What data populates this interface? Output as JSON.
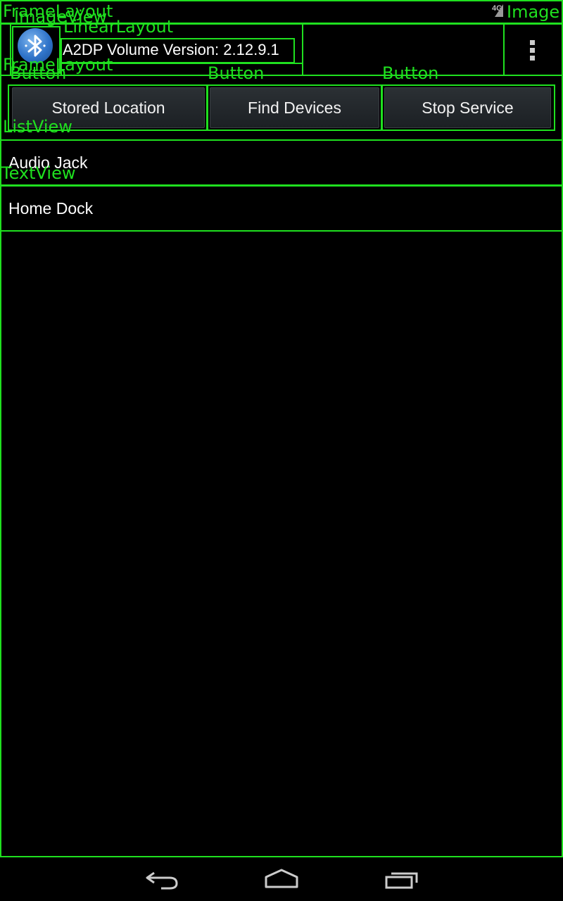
{
  "status_bar": {
    "network_label": "4G"
  },
  "action_bar": {
    "title": "A2DP Volume Version: 2.12.9.1",
    "icon": "bluetooth-icon",
    "menu_icon": "overflow-menu-icon"
  },
  "buttons": {
    "stored_location": "Stored Location",
    "find_devices": "Find Devices",
    "stop_service": "Stop Service"
  },
  "device_list": {
    "items": [
      {
        "label": "Audio Jack"
      },
      {
        "label": "Home Dock"
      }
    ]
  },
  "nav_bar": {
    "back_icon": "back-icon",
    "home_icon": "home-icon",
    "recents_icon": "recent-apps-icon"
  },
  "overlay_labels": {
    "frame_layout": "FrameLayout",
    "image_view": "ImageView",
    "linear_layout": "LinearLayout",
    "text_view": "TextView",
    "button": "Button",
    "list_view": "ListView",
    "image": "Image"
  },
  "colors": {
    "overlay": "#1fe01f",
    "background": "#000000",
    "button_bg": "#24292d"
  }
}
